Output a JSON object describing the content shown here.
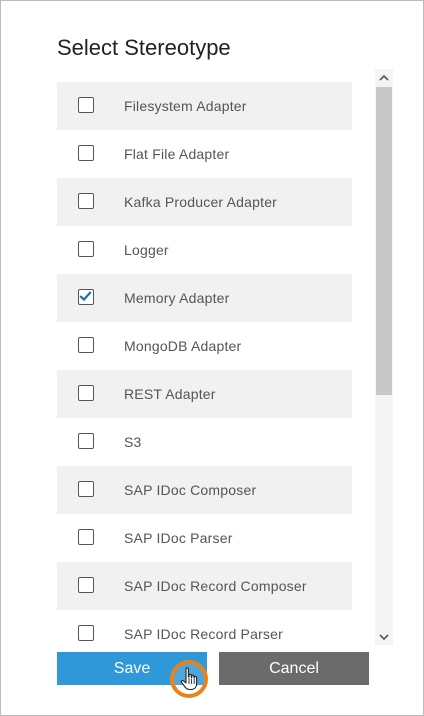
{
  "dialog": {
    "title": "Select Stereotype"
  },
  "list": {
    "items": [
      {
        "label": "Filesystem Adapter",
        "checked": false
      },
      {
        "label": "Flat File Adapter",
        "checked": false
      },
      {
        "label": "Kafka Producer Adapter",
        "checked": false
      },
      {
        "label": "Logger",
        "checked": false
      },
      {
        "label": "Memory Adapter",
        "checked": true
      },
      {
        "label": "MongoDB Adapter",
        "checked": false
      },
      {
        "label": "REST Adapter",
        "checked": false
      },
      {
        "label": "S3",
        "checked": false
      },
      {
        "label": "SAP IDoc Composer",
        "checked": false
      },
      {
        "label": "SAP IDoc Parser",
        "checked": false
      },
      {
        "label": "SAP IDoc Record Composer",
        "checked": false
      },
      {
        "label": "SAP IDoc Record Parser",
        "checked": false
      }
    ]
  },
  "buttons": {
    "save_label": "Save",
    "cancel_label": "Cancel"
  },
  "colors": {
    "save": "#2e98d8",
    "cancel": "#6b6b6b",
    "check": "#1f6fb2",
    "cursor_highlight": "#e8821e"
  },
  "icons": {
    "check": "check-icon",
    "scroll_up": "chevron-up-icon",
    "scroll_down": "chevron-down-icon",
    "cursor": "hand-pointer-icon"
  }
}
